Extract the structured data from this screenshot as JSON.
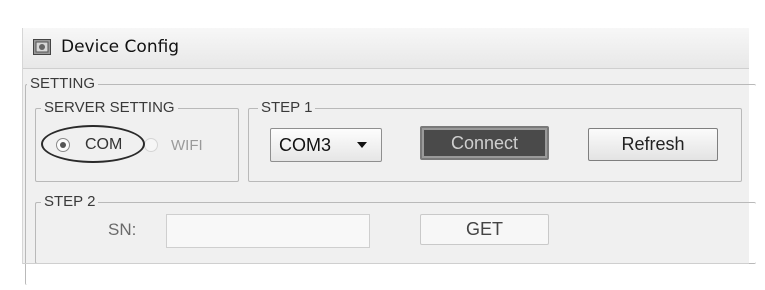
{
  "window": {
    "title": "Device Config",
    "app_icon": "settings-icon"
  },
  "setting": {
    "legend": "SETTING",
    "server_setting": {
      "legend": "SERVER SETTING",
      "options": [
        {
          "label": "COM",
          "selected": true
        },
        {
          "label": "WIFI",
          "selected": false
        }
      ]
    },
    "step1": {
      "legend": "STEP 1",
      "port_select": {
        "value": "COM3"
      },
      "connect_label": "Connect",
      "refresh_label": "Refresh"
    },
    "step2": {
      "legend": "STEP 2",
      "sn_label": "SN:",
      "sn_value": "",
      "get_label": "GET"
    }
  },
  "colors": {
    "connect_bg": "#4a4a4a",
    "window_bg": "#f0f0f0",
    "highlight_oval": "#2a2a2a"
  }
}
